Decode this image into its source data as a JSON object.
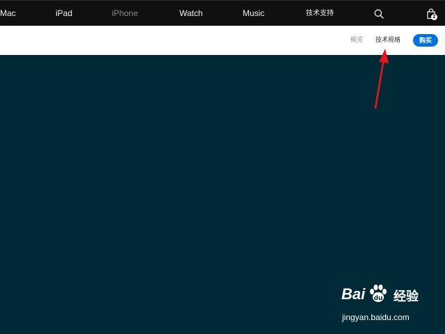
{
  "globalnav": {
    "items": [
      {
        "label": "Mac"
      },
      {
        "label": "iPad"
      },
      {
        "label": "iPhone"
      },
      {
        "label": "Watch"
      },
      {
        "label": "Music"
      },
      {
        "label": "技术支持"
      }
    ],
    "search_icon": "search-icon",
    "bag_icon": "bag-icon",
    "bag_count": "2",
    "background": "#101010",
    "active_item": "iPhone"
  },
  "localnav": {
    "overview_label": "概览",
    "specs_label": "技术规格",
    "buy_label": "购买",
    "buy_color": "#0071e3"
  },
  "hero": {
    "background": "#002b36"
  },
  "annotation": {
    "arrow_color": "#e8141c",
    "points_to": "技术规格"
  },
  "watermark": {
    "brand": "Bai",
    "brand_cn": "经验",
    "url": "jingyan.baidu.com"
  }
}
